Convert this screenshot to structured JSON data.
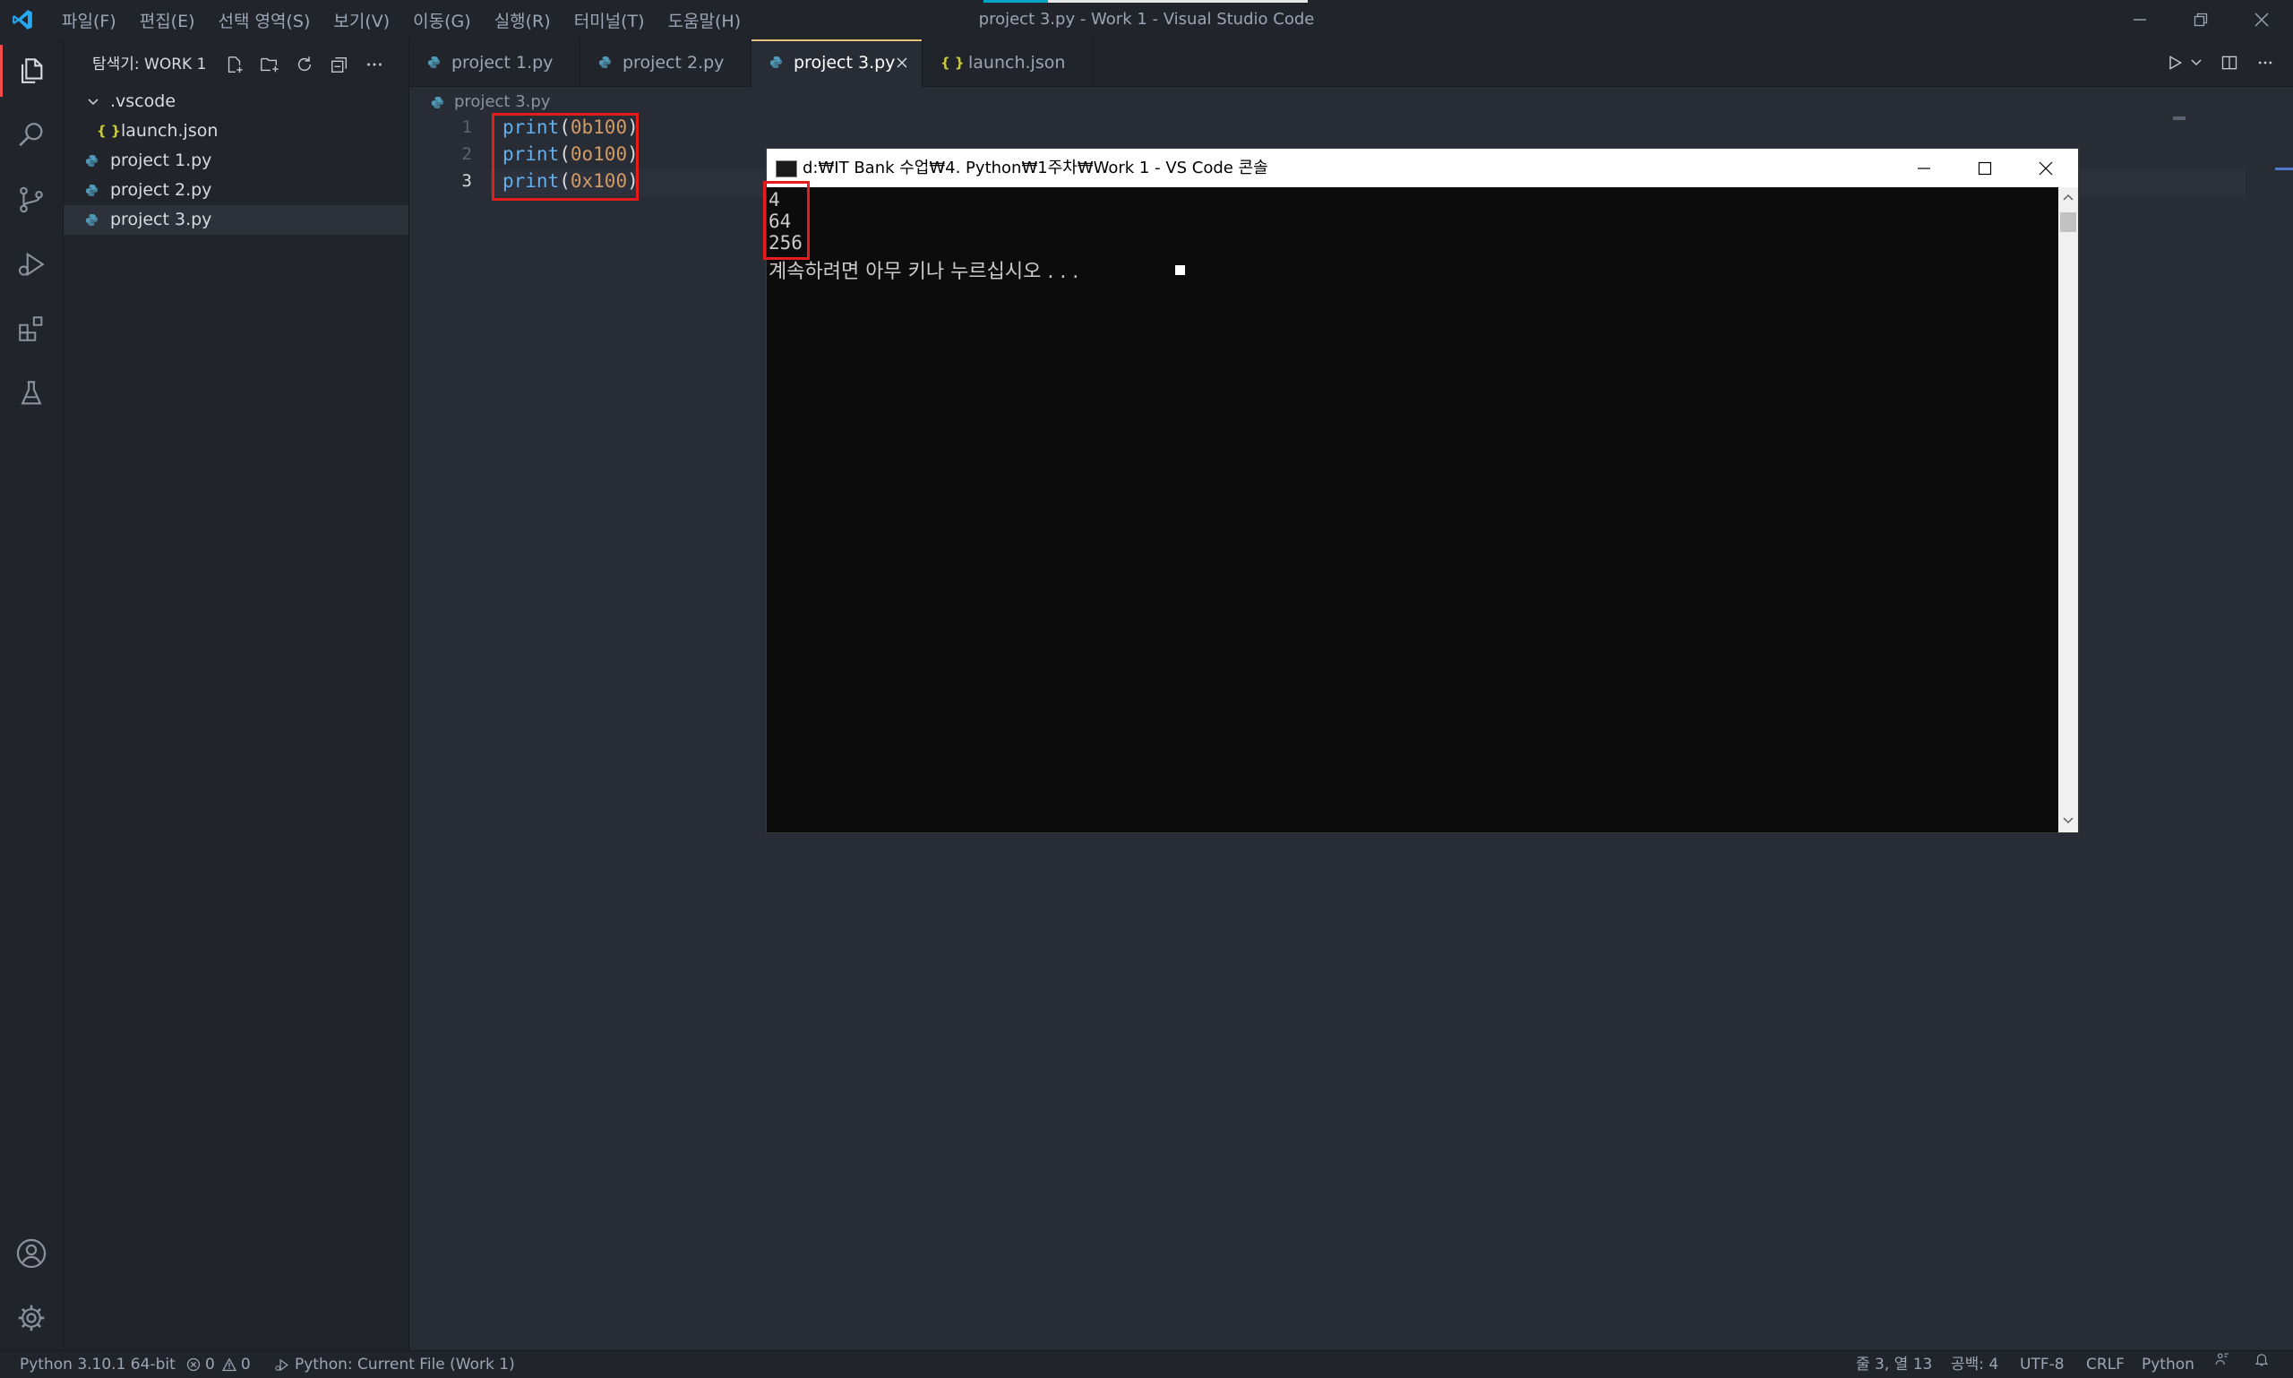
{
  "window": {
    "title": "project 3.py - Work 1 - Visual Studio Code",
    "menu": [
      "파일(F)",
      "편집(E)",
      "선택 영역(S)",
      "보기(V)",
      "이동(G)",
      "실행(R)",
      "터미널(T)",
      "도움말(H)"
    ]
  },
  "sidebar": {
    "title": "탐색기: WORK 1",
    "tree": [
      {
        "label": ".vscode",
        "type": "folder"
      },
      {
        "label": "launch.json",
        "type": "json"
      },
      {
        "label": "project 1.py",
        "type": "python"
      },
      {
        "label": "project 2.py",
        "type": "python"
      },
      {
        "label": "project 3.py",
        "type": "python",
        "selected": true
      }
    ]
  },
  "tabs": [
    {
      "label": "project 1.py",
      "type": "python"
    },
    {
      "label": "project 2.py",
      "type": "python"
    },
    {
      "label": "project 3.py",
      "type": "python",
      "active": true
    },
    {
      "label": "launch.json",
      "type": "json"
    }
  ],
  "editor": {
    "breadcrumb": "project 3.py",
    "lines": [
      {
        "number": "1",
        "fn": "print",
        "open": "(",
        "num": "0b100",
        "close": ")"
      },
      {
        "number": "2",
        "fn": "print",
        "open": "(",
        "num": "0o100",
        "close": ")"
      },
      {
        "number": "3",
        "fn": "print",
        "open": "(",
        "num": "0x100",
        "close": ")"
      }
    ]
  },
  "console": {
    "title": "d:₩IT Bank 수업₩4. Python₩1주차₩Work 1 - VS Code 콘솔",
    "output": [
      "4",
      "64",
      "256"
    ],
    "prompt": "계속하려면 아무 키나 누르십시오 . . ."
  },
  "statusbar": {
    "interpreter": "Python 3.10.1 64-bit",
    "errors": "0",
    "warnings": "0",
    "run_config": "Python: Current File (Work 1)",
    "position": "줄 3, 열 13",
    "spaces": "공백: 4",
    "encoding": "UTF-8",
    "eol": "CRLF",
    "language": "Python"
  },
  "colors": {
    "accent_red": "#e51c1c",
    "python_icon": "#519aba",
    "json_icon": "#cbcb41",
    "active_tab_border": "#e5c07b"
  }
}
